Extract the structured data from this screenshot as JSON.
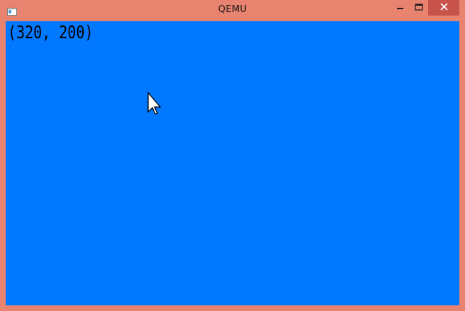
{
  "window": {
    "title": "QEMU",
    "frame_color": "#e8836f",
    "close_button_color": "#c7534a"
  },
  "titlebar": {
    "icon": "qemu-app-icon",
    "buttons": [
      "minimize-icon",
      "maximize-icon",
      "close-icon"
    ]
  },
  "guest_display": {
    "background_color": "#0078ff",
    "coordinate_text": "(320, 200)",
    "cursor_icon": "mouse-pointer-icon"
  }
}
